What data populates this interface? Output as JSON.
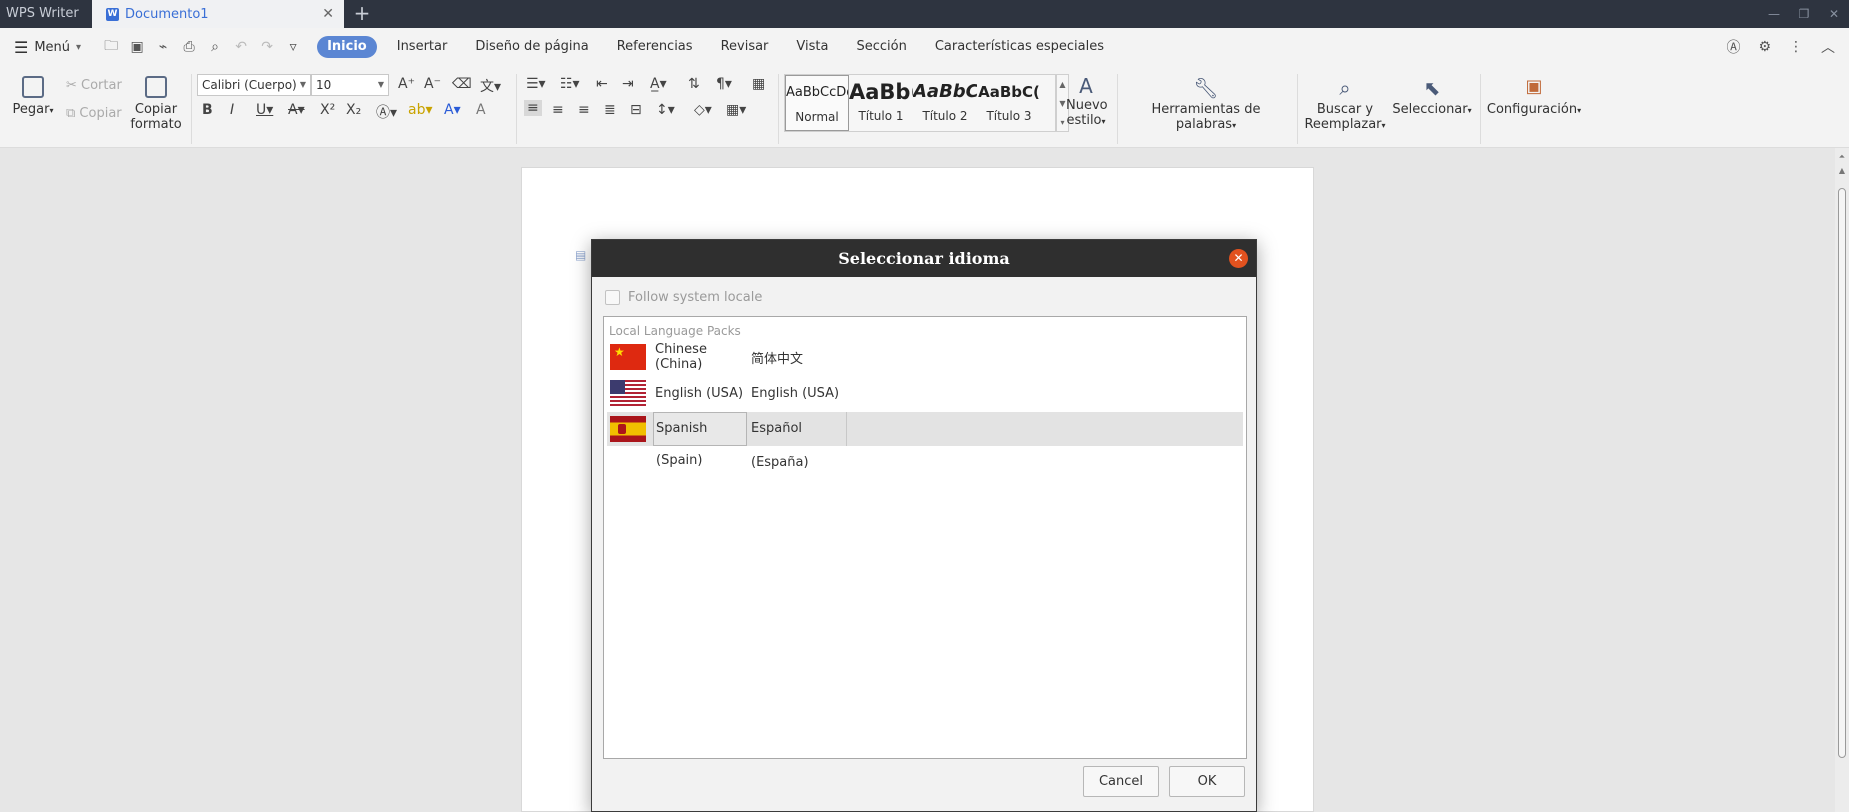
{
  "titlebar": {
    "app_name": "WPS Writer",
    "doc_title": "Documento1",
    "close_glyph": "✕",
    "add_glyph": "+"
  },
  "menubar": {
    "menu_label": "Menú",
    "tabs": [
      "Inicio",
      "Insertar",
      "Diseño de página",
      "Referencias",
      "Revisar",
      "Vista",
      "Sección",
      "Características especiales"
    ]
  },
  "ribbon": {
    "paste": "Pegar",
    "cut": "Cortar",
    "copy": "Copiar",
    "copy_format_1": "Copiar",
    "copy_format_2": "formato",
    "font_name": "Calibri (Cuerpo)",
    "font_size": "10",
    "styles": [
      {
        "preview": "AaBbCcDd",
        "name": "Normal"
      },
      {
        "preview": "AaBb(",
        "name": "Título 1"
      },
      {
        "preview": "AaBbC",
        "name": "Título 2"
      },
      {
        "preview": "AaBbC(",
        "name": "Título 3"
      }
    ],
    "new_style_1": "Nuevo",
    "new_style_2": "estilo",
    "word_tools": "Herramientas de palabras",
    "find_replace_1": "Buscar y",
    "find_replace_2": "Reemplazar",
    "select": "Seleccionar",
    "settings": "Configuración"
  },
  "dialog": {
    "title": "Seleccionar idioma",
    "follow_locale": "Follow system locale",
    "list_header": "Local Language Packs",
    "languages": [
      {
        "english": "Chinese (China)",
        "native": "简体中文",
        "flag": "china-flag-icon"
      },
      {
        "english": "English (USA)",
        "native": "English (USA)",
        "flag": "usa-flag-icon"
      },
      {
        "english": "Spanish (Spain)",
        "native": "Español (España)",
        "flag": "spain-flag-icon"
      }
    ],
    "selected_index": 2,
    "cancel": "Cancel",
    "ok": "OK"
  },
  "colors": {
    "titlebar_bg": "#2e3440",
    "active_tab_accent": "#5b86d3",
    "dialog_title_bg": "#2f2f2f",
    "dialog_close": "#e2521f"
  }
}
